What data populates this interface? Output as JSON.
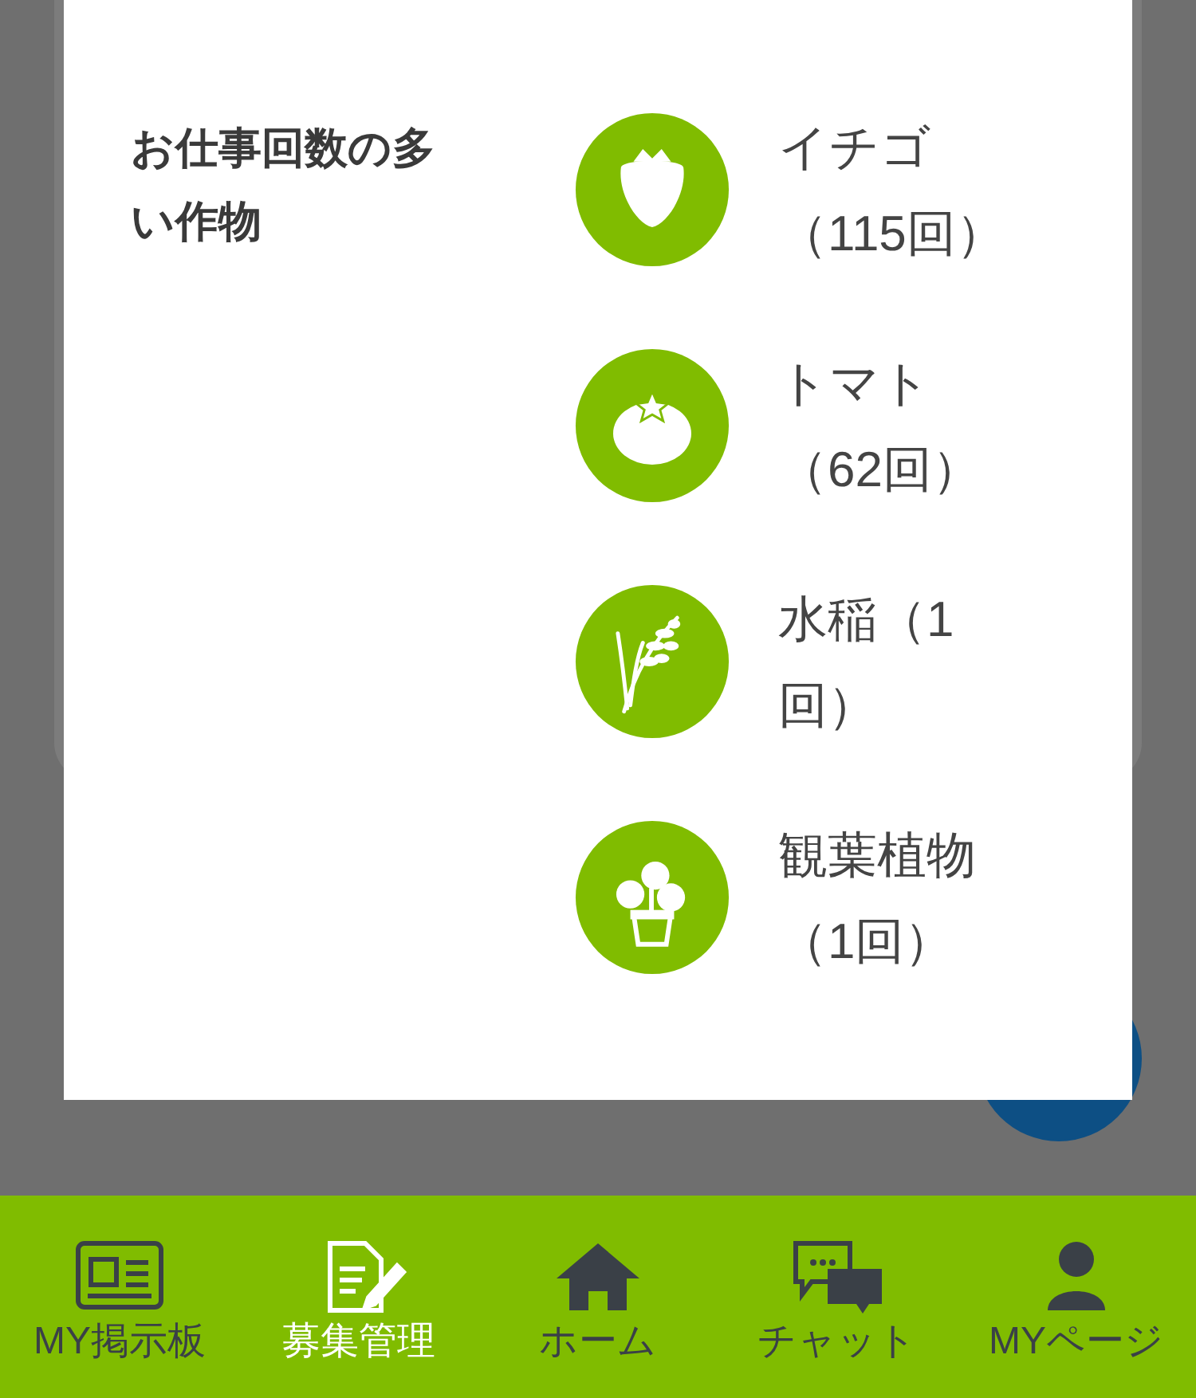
{
  "dialog": {
    "heading": "お仕事回数の多い作物",
    "crops": [
      {
        "kind": "strawberry",
        "label": "イチゴ（115回）"
      },
      {
        "kind": "tomato",
        "label": "トマト（62回）"
      },
      {
        "kind": "rice",
        "label": "水稲（1回）"
      },
      {
        "kind": "houseplant",
        "label": "観葉植物（1回）"
      }
    ]
  },
  "bottom_nav": [
    {
      "kind": "board",
      "label": "MY掲示板",
      "selected": false
    },
    {
      "kind": "recruit",
      "label": "募集管理",
      "selected": true
    },
    {
      "kind": "home",
      "label": "ホーム",
      "selected": false
    },
    {
      "kind": "chat",
      "label": "チャット",
      "selected": false
    },
    {
      "kind": "user",
      "label": "MYページ",
      "selected": false
    }
  ]
}
